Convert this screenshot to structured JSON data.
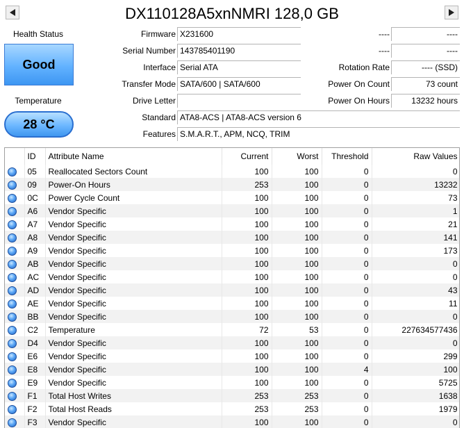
{
  "header": {
    "title": "DX110128A5xnNMRI 128,0 GB"
  },
  "status": {
    "health_label": "Health Status",
    "health_value": "Good",
    "temperature_label": "Temperature",
    "temperature_value": "28 °C",
    "health_color": "#62b2ff"
  },
  "fields": {
    "firmware": {
      "label": "Firmware",
      "value": "X231600"
    },
    "serial": {
      "label": "Serial Number",
      "value": "143785401190"
    },
    "interface": {
      "label": "Interface",
      "value": "Serial ATA"
    },
    "transfer": {
      "label": "Transfer Mode",
      "value": "SATA/600 | SATA/600"
    },
    "drive_letter": {
      "label": "Drive Letter",
      "value": ""
    },
    "standard": {
      "label": "Standard",
      "value": "ATA8-ACS | ATA8-ACS version 6"
    },
    "features": {
      "label": "Features",
      "value": "S.M.A.R.T., APM, NCQ, TRIM"
    },
    "right1": {
      "label": "----",
      "value": "----"
    },
    "right2": {
      "label": "----",
      "value": "----"
    },
    "rotation": {
      "label": "Rotation Rate",
      "value": "---- (SSD)"
    },
    "power_on_count": {
      "label": "Power On Count",
      "value": "73 count"
    },
    "power_on_hours": {
      "label": "Power On Hours",
      "value": "13232 hours"
    }
  },
  "table": {
    "headers": [
      "",
      "ID",
      "Attribute Name",
      "Current",
      "Worst",
      "Threshold",
      "Raw Values"
    ],
    "rows": [
      {
        "id": "05",
        "name": "Reallocated Sectors Count",
        "current": "100",
        "worst": "100",
        "threshold": "0",
        "raw": "0"
      },
      {
        "id": "09",
        "name": "Power-On Hours",
        "current": "253",
        "worst": "100",
        "threshold": "0",
        "raw": "13232"
      },
      {
        "id": "0C",
        "name": "Power Cycle Count",
        "current": "100",
        "worst": "100",
        "threshold": "0",
        "raw": "73"
      },
      {
        "id": "A6",
        "name": "Vendor Specific",
        "current": "100",
        "worst": "100",
        "threshold": "0",
        "raw": "1"
      },
      {
        "id": "A7",
        "name": "Vendor Specific",
        "current": "100",
        "worst": "100",
        "threshold": "0",
        "raw": "21"
      },
      {
        "id": "A8",
        "name": "Vendor Specific",
        "current": "100",
        "worst": "100",
        "threshold": "0",
        "raw": "141"
      },
      {
        "id": "A9",
        "name": "Vendor Specific",
        "current": "100",
        "worst": "100",
        "threshold": "0",
        "raw": "173"
      },
      {
        "id": "AB",
        "name": "Vendor Specific",
        "current": "100",
        "worst": "100",
        "threshold": "0",
        "raw": "0"
      },
      {
        "id": "AC",
        "name": "Vendor Specific",
        "current": "100",
        "worst": "100",
        "threshold": "0",
        "raw": "0"
      },
      {
        "id": "AD",
        "name": "Vendor Specific",
        "current": "100",
        "worst": "100",
        "threshold": "0",
        "raw": "43"
      },
      {
        "id": "AE",
        "name": "Vendor Specific",
        "current": "100",
        "worst": "100",
        "threshold": "0",
        "raw": "11"
      },
      {
        "id": "BB",
        "name": "Vendor Specific",
        "current": "100",
        "worst": "100",
        "threshold": "0",
        "raw": "0"
      },
      {
        "id": "C2",
        "name": "Temperature",
        "current": "72",
        "worst": "53",
        "threshold": "0",
        "raw": "227634577436"
      },
      {
        "id": "D4",
        "name": "Vendor Specific",
        "current": "100",
        "worst": "100",
        "threshold": "0",
        "raw": "0"
      },
      {
        "id": "E6",
        "name": "Vendor Specific",
        "current": "100",
        "worst": "100",
        "threshold": "0",
        "raw": "299"
      },
      {
        "id": "E8",
        "name": "Vendor Specific",
        "current": "100",
        "worst": "100",
        "threshold": "4",
        "raw": "100"
      },
      {
        "id": "E9",
        "name": "Vendor Specific",
        "current": "100",
        "worst": "100",
        "threshold": "0",
        "raw": "5725"
      },
      {
        "id": "F1",
        "name": "Total Host Writes",
        "current": "253",
        "worst": "253",
        "threshold": "0",
        "raw": "1638"
      },
      {
        "id": "F2",
        "name": "Total Host Reads",
        "current": "253",
        "worst": "253",
        "threshold": "0",
        "raw": "1979"
      },
      {
        "id": "F3",
        "name": "Vendor Specific",
        "current": "100",
        "worst": "100",
        "threshold": "0",
        "raw": "0"
      }
    ]
  },
  "icons": {
    "prev": "triangle-left-icon",
    "next": "triangle-right-icon",
    "status_dot": "blue-status-dot-icon"
  }
}
